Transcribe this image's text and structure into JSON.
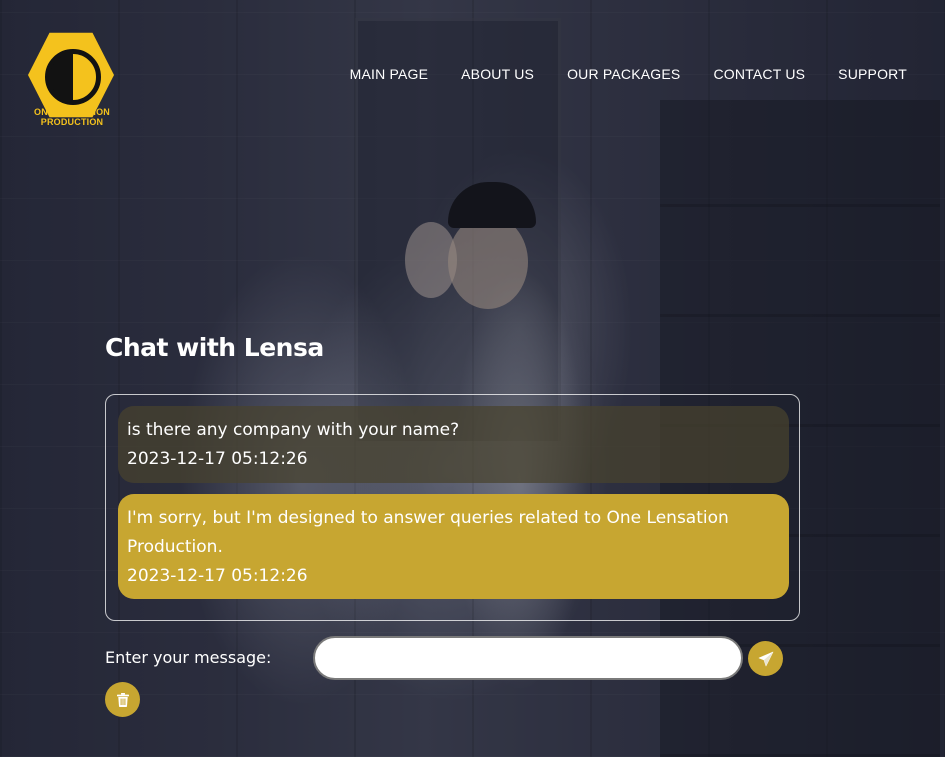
{
  "brand": {
    "name_line1": "ONE LENSATION",
    "name_line2": "PRODUCTION",
    "color": "#f4c21d"
  },
  "nav": {
    "items": [
      {
        "label": "MAIN PAGE"
      },
      {
        "label": "ABOUT US"
      },
      {
        "label": "OUR PACKAGES"
      },
      {
        "label": "CONTACT US"
      },
      {
        "label": "SUPPORT"
      }
    ]
  },
  "chat": {
    "title": "Chat with Lensa",
    "messages": [
      {
        "sender": "user",
        "text": "is there any company with your name?",
        "time": "2023-12-17 05:12:26"
      },
      {
        "sender": "bot",
        "text": "I'm sorry, but I'm designed to answer queries related to One Lensation Production.",
        "time": "2023-12-17 05:12:26"
      }
    ],
    "input": {
      "label": "Enter your message:",
      "value": "",
      "placeholder": ""
    },
    "send_icon": "paper-plane-icon",
    "delete_icon": "trash-icon",
    "accent": "#c7a631"
  }
}
